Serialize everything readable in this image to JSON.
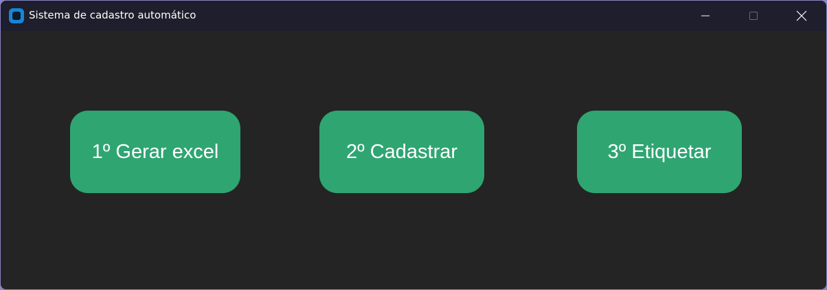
{
  "window": {
    "title": "Sistema de cadastro automático",
    "app_icon": "app-icon",
    "controls": {
      "minimize_icon": "minimize-icon",
      "maximize_icon": "maximize-icon",
      "close_icon": "close-icon"
    }
  },
  "main": {
    "buttons": [
      {
        "label": "1º Gerar excel"
      },
      {
        "label": "2º Cadastrar"
      },
      {
        "label": "3º Etiquetar"
      }
    ]
  },
  "colors": {
    "titlebar_bg": "#1e1e2c",
    "content_bg": "#242424",
    "button_bg": "#2fa572",
    "button_text": "#ffffff",
    "app_icon": "#1686d8"
  }
}
